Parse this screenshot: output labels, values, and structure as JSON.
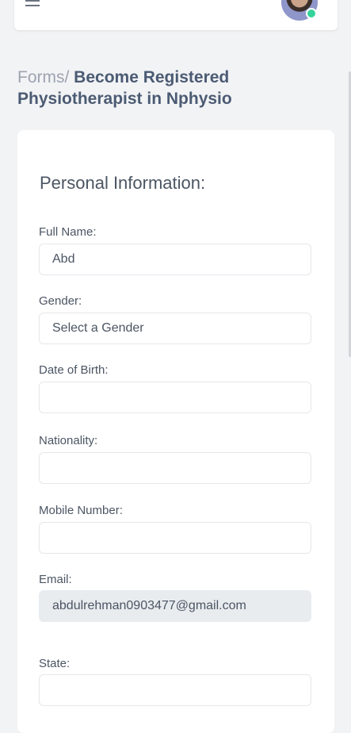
{
  "header": {
    "menu_icon": "hamburger-icon",
    "avatar_icon": "user-avatar",
    "status_color": "#34d399"
  },
  "breadcrumb": {
    "root": "Forms/",
    "current": "Become Registered Physiotherapist in Nphysio"
  },
  "form": {
    "section_title": "Personal Information:",
    "full_name": {
      "label": "Full Name:",
      "value": "Abd"
    },
    "gender": {
      "label": "Gender:",
      "value": "Select a Gender"
    },
    "dob": {
      "label": "Date of Birth:",
      "value": ""
    },
    "nationality": {
      "label": "Nationality:",
      "value": ""
    },
    "mobile": {
      "label": "Mobile Number:",
      "value": ""
    },
    "email": {
      "label": "Email:",
      "value": "abdulrehman0903477@gmail.com"
    },
    "state": {
      "label": "State:",
      "value": ""
    }
  },
  "colors": {
    "background": "#f2f3f5",
    "card": "#ffffff",
    "readonly_field": "#e9ecef",
    "title_text": "#4b5b73"
  }
}
